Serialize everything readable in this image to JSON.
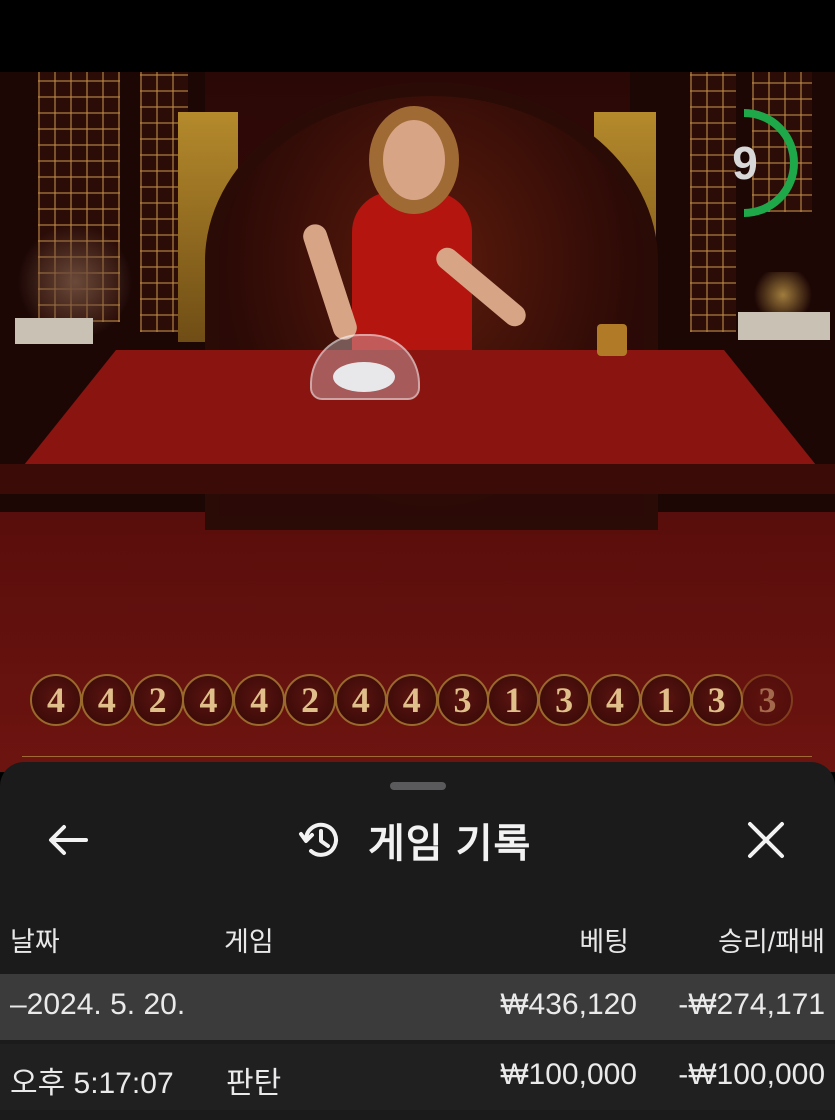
{
  "timer": {
    "seconds": "9",
    "progress": 0.5
  },
  "bead_road": [
    "4",
    "4",
    "2",
    "4",
    "4",
    "2",
    "4",
    "4",
    "3",
    "1",
    "3",
    "4",
    "1",
    "3",
    "3"
  ],
  "panel": {
    "title": "게임 기록",
    "columns": {
      "date": "날짜",
      "game": "게임",
      "bet": "베팅",
      "win_loss": "승리/패배"
    },
    "summary": {
      "date": "–2024. 5. 20.",
      "bet": "₩436,120",
      "win_loss": "-₩274,171"
    },
    "rows": [
      {
        "time": "오후 5:17:07",
        "game": "판탄",
        "bet": "₩100,000",
        "win_loss": "-₩100,000"
      }
    ]
  },
  "colors": {
    "timer_ring": "#1ea84a",
    "sheet_bg": "#1b1b1c",
    "bead_text": "#e0bf8a"
  }
}
